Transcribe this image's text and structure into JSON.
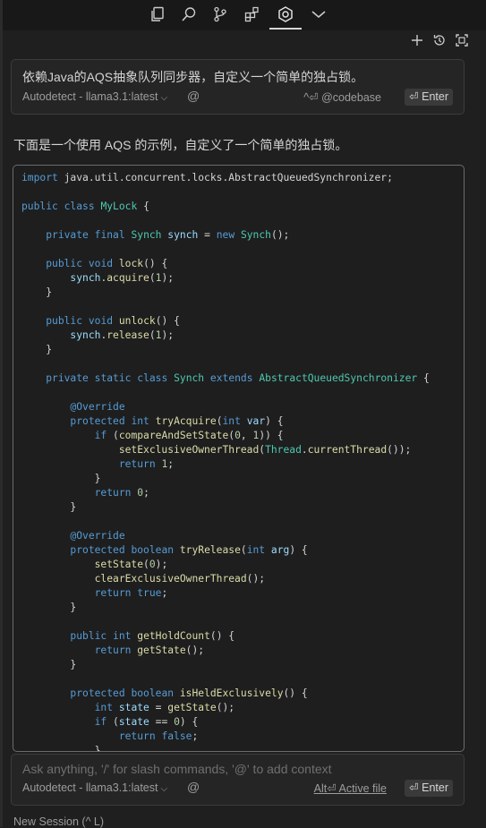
{
  "toolbar": {
    "icons": [
      "copy-icon",
      "search-icon",
      "source-control-icon",
      "extensions-icon",
      "continue-icon",
      "chevron-down-icon"
    ],
    "secondary_icons": [
      "plus-icon",
      "history-icon",
      "fullscreen-icon"
    ]
  },
  "query": {
    "text": "依赖Java的AQS抽象队列同步器，自定义一个简单的独占锁。",
    "model": "Autodetect - llama3.1:latest",
    "at": "@",
    "codebase_hint": "^⏎ @codebase",
    "enter_label": "⏎ Enter"
  },
  "answer": {
    "intro": "下面是一个使用 AQS 的示例，自定义了一个简单的独占锁。"
  },
  "code": {
    "language": "java",
    "lines": [
      "import java.util.concurrent.locks.AbstractQueuedSynchronizer;",
      "",
      "public class MyLock {",
      "",
      "    private final Synch synch = new Synch();",
      "",
      "    public void lock() {",
      "        synch.acquire(1);",
      "    }",
      "",
      "    public void unlock() {",
      "        synch.release(1);",
      "    }",
      "",
      "    private static class Synch extends AbstractQueuedSynchronizer {",
      "",
      "        @Override",
      "        protected int tryAcquire(int var) {",
      "            if (compareAndSetState(0, 1)) {",
      "                setExclusiveOwnerThread(Thread.currentThread());",
      "                return 1;",
      "            }",
      "            return 0;",
      "        }",
      "",
      "        @Override",
      "        protected boolean tryRelease(int arg) {",
      "            setState(0);",
      "            clearExclusiveOwnerThread();",
      "            return true;",
      "        }",
      "",
      "        public int getHoldCount() {",
      "            return getState();",
      "        }",
      "",
      "        protected boolean isHeldExclusively() {",
      "            int state = getState();",
      "            if (state == 0) {",
      "                return false;",
      "            }"
    ]
  },
  "ask": {
    "placeholder": "Ask anything, '/' for slash commands, '@' to add context",
    "model": "Autodetect - llama3.1:latest",
    "at": "@",
    "active_file_hint": "Alt⏎ Active file",
    "enter_label": "⏎ Enter"
  },
  "footer": {
    "new_session": "New Session (^ L)"
  },
  "colors": {
    "background": "#1f1f1f",
    "panel": "#252526",
    "keyword": "#569cd6",
    "type": "#4ec9b0",
    "function": "#dcdcaa",
    "variable": "#9cdcfe",
    "number": "#b5cea8"
  }
}
